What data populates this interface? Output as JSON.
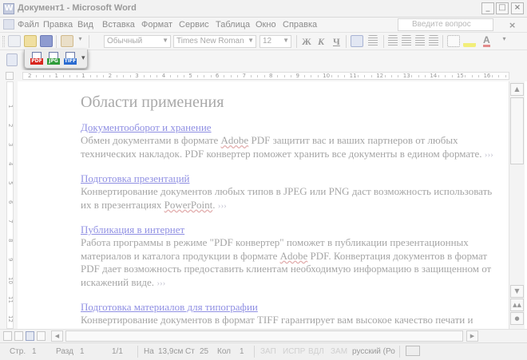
{
  "window": {
    "title": "Документ1 - Microsoft Word",
    "buttons": {
      "minimize": "_",
      "maximize": "□",
      "close": "×"
    }
  },
  "menubar": {
    "items": [
      "Файл",
      "Правка",
      "Вид",
      "Вставка",
      "Формат",
      "Сервис",
      "Таблица",
      "Окно",
      "Справка"
    ],
    "help_placeholder": "Введите вопрос",
    "close_doc": "×"
  },
  "formatting_toolbar": {
    "style": "Обычный",
    "font": "Times New Roman",
    "size": "12",
    "bold": "Ж",
    "italic": "К",
    "underline": "Ч",
    "font_color_letter": "A"
  },
  "pdf_toolbar": {
    "items": [
      {
        "label": "PDF",
        "color": "#d8261f"
      },
      {
        "label": "JPG",
        "color": "#2f9c3a"
      },
      {
        "label": "TIFF",
        "color": "#2a6bd0"
      }
    ],
    "more": "▾"
  },
  "ruler": {
    "numbers": [
      "2",
      "1",
      "1",
      "2",
      "3",
      "4",
      "5",
      "6",
      "7",
      "8",
      "9",
      "10",
      "11",
      "12",
      "13",
      "14",
      "15",
      "16"
    ],
    "vertical_numbers": [
      "1",
      "2",
      "3",
      "4",
      "5",
      "6",
      "7",
      "8",
      "9",
      "10",
      "11",
      "12"
    ]
  },
  "document": {
    "heading": "Области применения",
    "sections": [
      {
        "title": "Документооборот и хранение",
        "parts": [
          {
            "text": "Обмен документами в формате "
          },
          {
            "text": "Adobe",
            "wavy": true
          },
          {
            "text": " PDF защитит вас и ваших партнеров от любых технических накладок. PDF конвертер поможет хранить все документы в едином формате. "
          },
          {
            "text": "›››",
            "mark": true
          }
        ]
      },
      {
        "title": "Подготовка презентаций",
        "parts": [
          {
            "text": "Конвертирование документов любых типов в JPEG или PNG даст возможность использовать их в презентациях "
          },
          {
            "text": "PowerPoint",
            "wavy": true
          },
          {
            "text": ". "
          },
          {
            "text": "›››",
            "mark": true
          }
        ]
      },
      {
        "title": "Публикация в интернет",
        "parts": [
          {
            "text": "Работа программы в режиме \"PDF конвертер\" поможет в публикации презентационных материалов и каталога продукции в формате "
          },
          {
            "text": "Adobe",
            "wavy": true
          },
          {
            "text": " PDF. Конвертация документов в формат PDF дает возможность предоставить клиентам необходимую информацию в защищенном от искажений виде. "
          },
          {
            "text": "›››",
            "mark": true
          }
        ]
      },
      {
        "title": "Подготовка материалов для типографии",
        "parts": [
          {
            "text": "Конвертирование документов в формат TIFF гарантирует вам высокое качество печати и"
          }
        ]
      }
    ]
  },
  "statusbar": {
    "page": "Стр.",
    "page_num": "1",
    "section": "Разд",
    "section_num": "1",
    "pages": "1/1",
    "position": "На",
    "position_val": "13,9см",
    "line": "Ст",
    "line_num": "25",
    "column": "Кол",
    "column_num": "1",
    "rec": "ЗАП",
    "trk": "ИСПР",
    "ext": "ВДЛ",
    "ovr": "ЗАМ",
    "language": "русский (Ро"
  }
}
